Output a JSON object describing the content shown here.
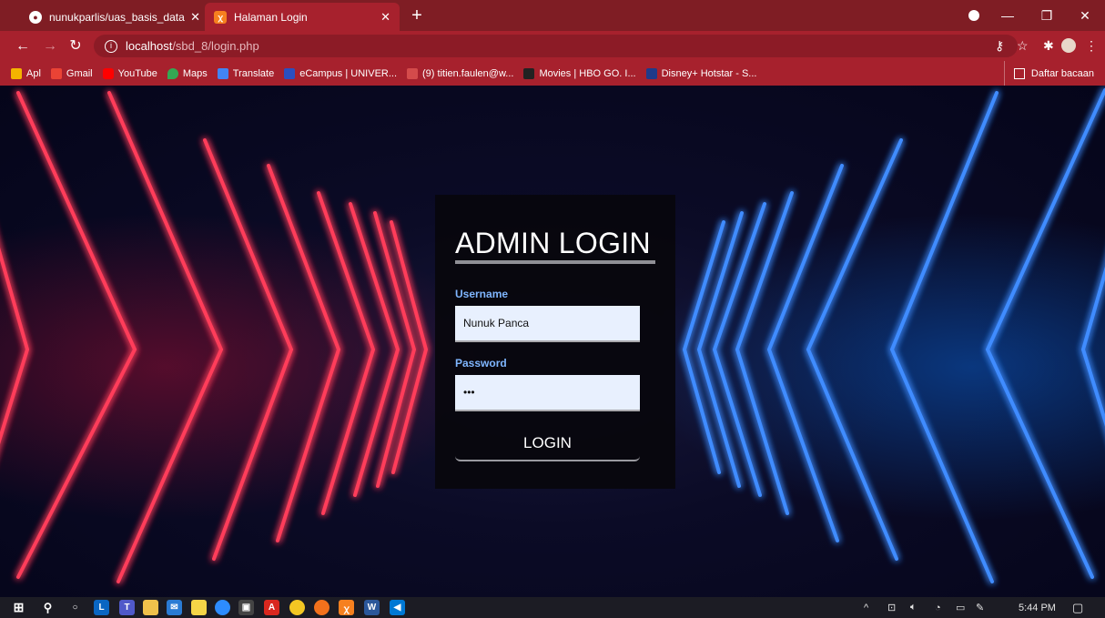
{
  "browser": {
    "tabs": [
      {
        "label": "nunukparlis/uas_basis_data",
        "icon": "github-icon",
        "active": false
      },
      {
        "label": "Halaman Login",
        "icon": "xampp-icon",
        "active": true
      }
    ],
    "new_tab": "+",
    "address": {
      "host": "localhost",
      "path": "/sbd_8/login.php"
    },
    "bookmarks": [
      {
        "label": "Apl",
        "icon": "apps-grid-icon",
        "color": "#f4b400"
      },
      {
        "label": "Gmail",
        "icon": "gmail-icon",
        "color": "#ea4335"
      },
      {
        "label": "YouTube",
        "icon": "youtube-icon",
        "color": "#ff0000"
      },
      {
        "label": "Maps",
        "icon": "maps-icon",
        "color": "#34a853"
      },
      {
        "label": "Translate",
        "icon": "translate-icon",
        "color": "#4285f4"
      },
      {
        "label": "eCampus | UNIVER...",
        "icon": "ecampus-icon",
        "color": "#2b4fbf"
      },
      {
        "label": "(9) titien.faulen@w...",
        "icon": "mail-icon",
        "color": "#d44b4b"
      },
      {
        "label": "Movies | HBO GO. I...",
        "icon": "hbo-icon",
        "color": "#222222"
      },
      {
        "label": "Disney+ Hotstar - S...",
        "icon": "hotstar-icon",
        "color": "#1f3a8a"
      }
    ],
    "reading_list": "Daftar bacaan",
    "theme_color": "#a7212d"
  },
  "login": {
    "title": "ADMIN LOGIN",
    "username_label": "Username",
    "username_value": "Nunuk Panca",
    "password_label": "Password",
    "password_value": "•••",
    "button_label": "LOGIN",
    "label_color": "#7fb6ff"
  },
  "taskbar": {
    "time": "5:44 PM",
    "apps": [
      "windows-start-icon",
      "search-icon",
      "cortana-icon",
      "linkedin-learning-icon",
      "teams-icon",
      "file-explorer-icon",
      "mail-icon",
      "sticky-notes-icon",
      "zoom-icon",
      "store-icon",
      "acrobat-icon",
      "chrome-icon",
      "firefox-icon",
      "xampp-icon",
      "word-icon",
      "vscode-icon"
    ]
  }
}
